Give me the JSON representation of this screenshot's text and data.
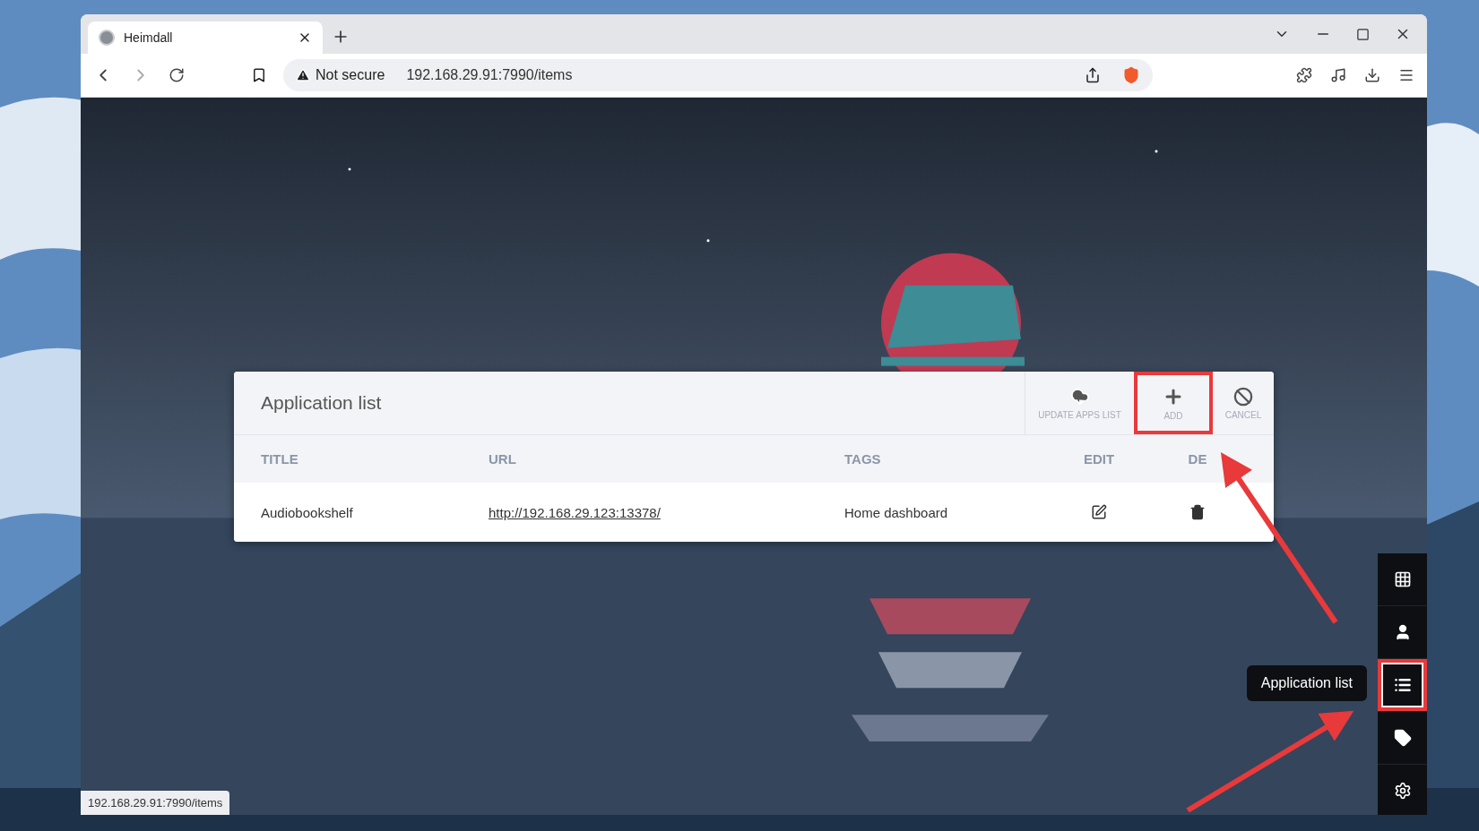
{
  "browser": {
    "tab": {
      "title": "Heimdall"
    },
    "address": {
      "security": "Not secure",
      "url": "192.168.29.91:7990/items"
    }
  },
  "panel": {
    "title": "Application list",
    "actions": [
      {
        "kind": "download",
        "label": "UPDATE APPS LIST",
        "highlighted": false
      },
      {
        "kind": "add",
        "label": "ADD",
        "highlighted": true
      },
      {
        "kind": "cancel",
        "label": "CANCEL",
        "highlighted": false
      }
    ],
    "columns": [
      "TITLE",
      "URL",
      "TAGS",
      "EDIT",
      "DE"
    ],
    "rows": [
      {
        "title": "Audiobookshelf",
        "url": "http://192.168.29.123:13378/",
        "tags": "Home dashboard"
      }
    ]
  },
  "sidebar": {
    "tooltip": "Application list",
    "items": [
      {
        "kind": "apps",
        "highlighted": false
      },
      {
        "kind": "user",
        "highlighted": false
      },
      {
        "kind": "list",
        "highlighted": true
      },
      {
        "kind": "tag",
        "highlighted": false
      },
      {
        "kind": "settings",
        "highlighted": false
      }
    ]
  },
  "status_bar": "192.168.29.91:7990/items"
}
